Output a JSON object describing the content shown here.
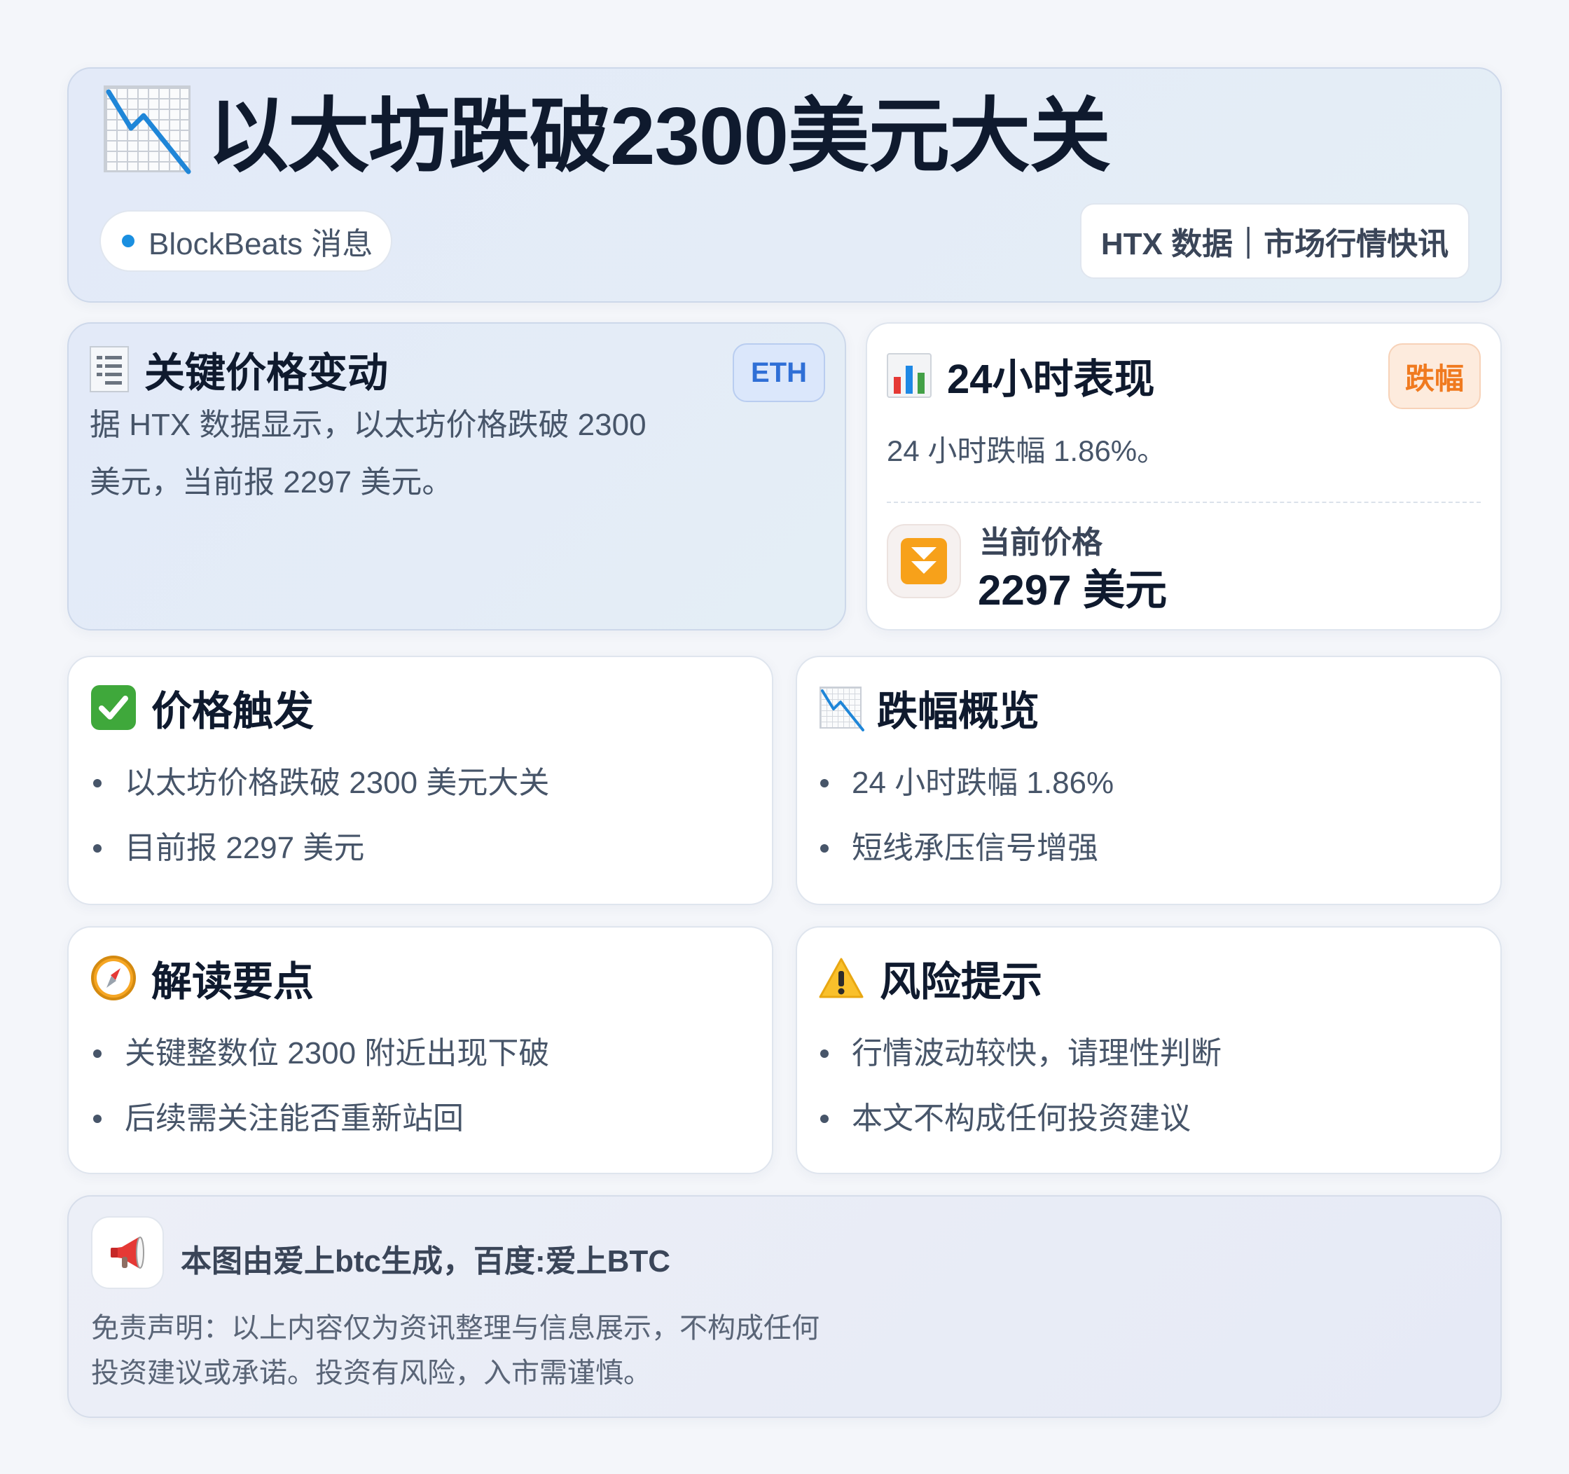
{
  "header": {
    "title": "以太坊跌破2300美元大关",
    "source_label": "BlockBeats 消息",
    "data_label": "HTX 数据｜市场行情快讯"
  },
  "key_change": {
    "title": "关键价格变动",
    "badge": "ETH",
    "body_line1": "据 HTX 数据显示，以太坊价格跌破 2300",
    "body_line2": "美元，当前报 2297 美元。"
  },
  "performance": {
    "title": "24小时表现",
    "badge": "跌幅",
    "summary": "24 小时跌幅 1.86%。",
    "price_label": "当前价格",
    "price_value": "2297 美元"
  },
  "trigger": {
    "title": "价格触发",
    "items": [
      "以太坊价格跌破 2300 美元大关",
      "目前报 2297 美元"
    ]
  },
  "drop_overview": {
    "title": "跌幅概览",
    "items": [
      "24 小时跌幅 1.86%",
      "短线承压信号增强"
    ]
  },
  "interpretation": {
    "title": "解读要点",
    "items": [
      "关键整数位 2300 附近出现下破",
      "后续需关注能否重新站回"
    ]
  },
  "risk": {
    "title": "风险提示",
    "items": [
      "行情波动较快，请理性判断",
      "本文不构成任何投资建议"
    ]
  },
  "footer": {
    "credit": "本图由爱上btc生成，百度:爱上BTC",
    "disclaimer_line1": "免责声明：以上内容仅为资讯整理与信息展示，不构成任何",
    "disclaimer_line2": "投资建议或承诺。投资有风险，入市需谨慎。"
  },
  "icons": {
    "title": "chart-decreasing-icon",
    "key_change": "receipt-icon",
    "performance": "bar-chart-icon",
    "price": "fast-down-arrow-icon",
    "trigger": "check-mark-icon",
    "drop_overview": "chart-decreasing-icon",
    "interpretation": "compass-icon",
    "risk": "warning-icon",
    "footer": "megaphone-icon"
  },
  "colors": {
    "accent_blue": "#1a8fe0",
    "eth_badge_bg": "#dbe7fb",
    "eth_badge_text": "#2f6fd6",
    "drop_badge_bg": "#fdebdd",
    "drop_badge_text": "#f07a1f",
    "trend_line": "#1f86d8"
  }
}
